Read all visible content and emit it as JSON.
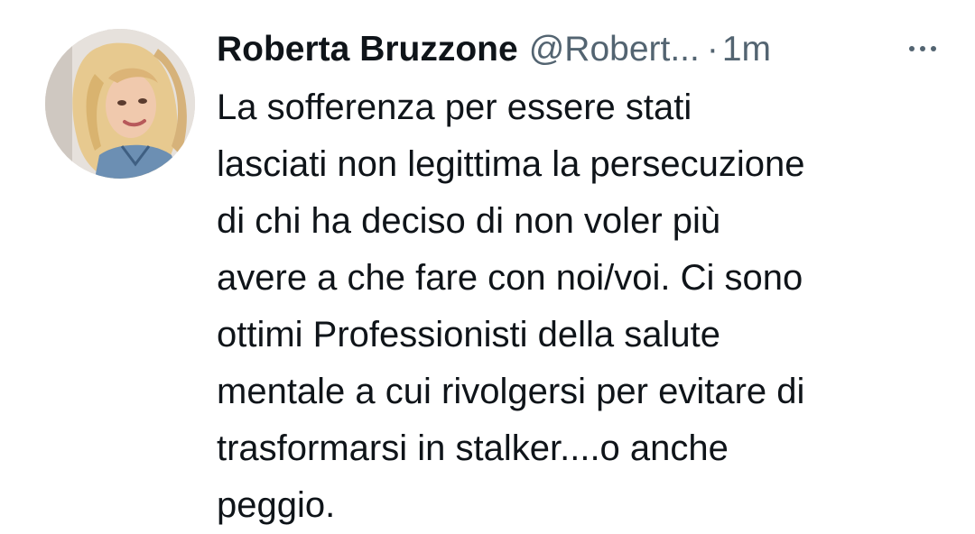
{
  "tweet": {
    "author": {
      "display_name": "Roberta Bruzzone",
      "handle": "@Robert...",
      "avatar_icon": "profile-photo"
    },
    "separator": "·",
    "timestamp": "1m",
    "more_icon": "more-horizontal-icon",
    "text_lines": [
      "La sofferenza per essere stati",
      "lasciati non legittima la persecuzione",
      "di chi ha deciso di non voler più",
      "avere a che fare con noi/voi. Ci sono",
      "ottimi Professionisti della salute",
      "mentale a cui rivolgersi per evitare di",
      "trasformarsi in stalker....o anche",
      "peggio."
    ]
  },
  "colors": {
    "text_primary": "#0f1419",
    "text_secondary": "#536471",
    "background": "#ffffff"
  }
}
